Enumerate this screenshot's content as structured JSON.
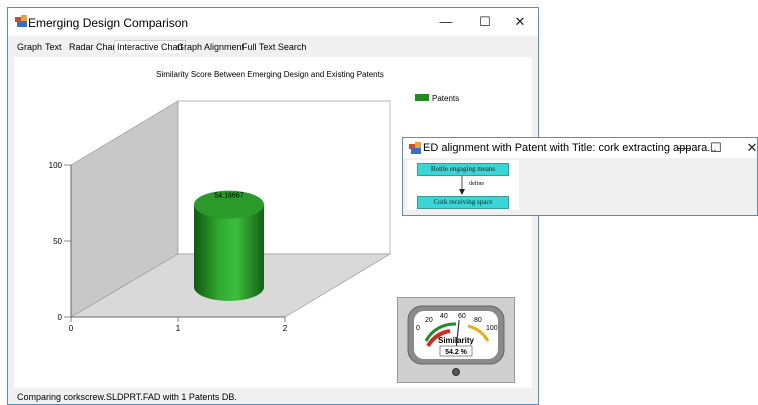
{
  "main_window": {
    "title": "Emerging Design Comparison",
    "controls": {
      "minimize": "—",
      "maximize": "☐",
      "close": "✕"
    }
  },
  "tabs": [
    {
      "label": "Graph"
    },
    {
      "label": "Text"
    },
    {
      "label": "Radar Chart"
    },
    {
      "label": "Interactive Chart",
      "active": true
    },
    {
      "label": "Graph Alignment"
    },
    {
      "label": "Full Text Search"
    }
  ],
  "chart_data": {
    "type": "bar",
    "title": "Similarity Score Between Emerging Design and Existing Patents",
    "categories": [
      "1"
    ],
    "series": [
      {
        "name": "Patents",
        "values": [
          54.16667
        ],
        "color": "#228b22"
      }
    ],
    "data_labels": [
      "54.16667"
    ],
    "x_ticks": [
      "0",
      "1",
      "2"
    ],
    "y_ticks": [
      "0",
      "50",
      "100"
    ],
    "ylim": [
      0,
      100
    ],
    "three_d": true,
    "legend_position": "top-right"
  },
  "gauge": {
    "label": "Similarity",
    "value_text": "54.2 %",
    "value": 54.2,
    "scale_labels": [
      "0",
      "20",
      "40",
      "60",
      "80",
      "100"
    ]
  },
  "status_text": "Comparing corkscrew.SLDPRT.FAD with 1 Patents DB.",
  "alignment_window": {
    "title": "ED alignment with Patent with Title: cork  extracting appara...",
    "controls": {
      "minimize": "—",
      "maximize": "☐",
      "close": "✕"
    },
    "node_top": "Bottle engaging means",
    "edge_label": "define",
    "node_bottom": "Cork receiving space"
  }
}
